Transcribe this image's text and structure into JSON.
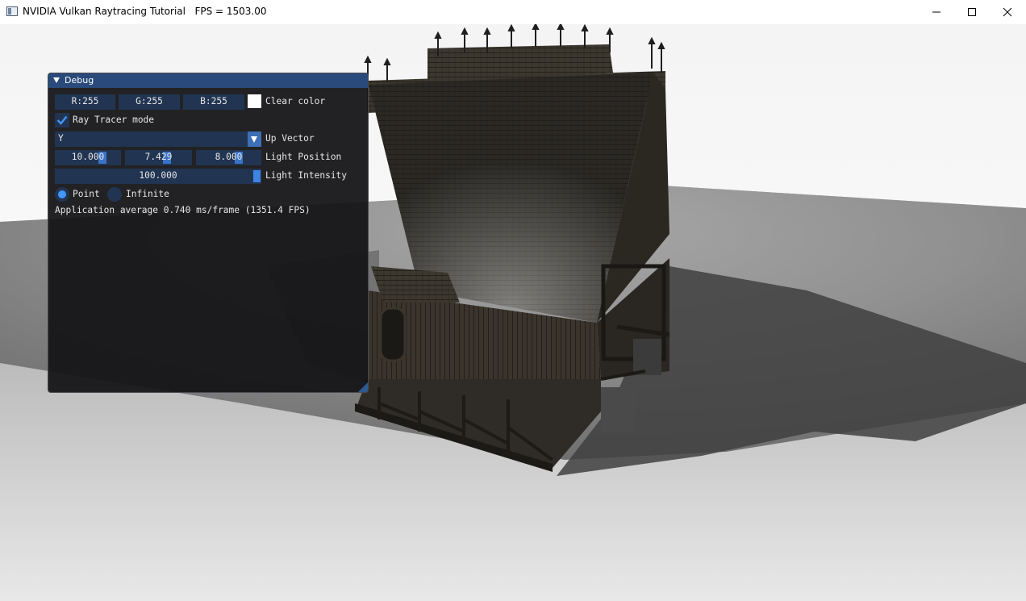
{
  "window": {
    "title": "NVIDIA Vulkan Raytracing Tutorial",
    "fps_text": "FPS = 1503.00"
  },
  "debug_panel": {
    "title": "Debug",
    "clear_color": {
      "r_text": "R:255",
      "g_text": "G:255",
      "b_text": "B:255",
      "label": "Clear color",
      "swatch_color": "#ffffff"
    },
    "ray_tracer_mode": {
      "label": "Ray Tracer mode",
      "checked": true
    },
    "up_vector": {
      "value": "Y",
      "label": "Up Vector"
    },
    "light_position": {
      "x": "10.000",
      "y": "7.429",
      "z": "8.000",
      "label": "Light Position"
    },
    "light_intensity": {
      "value": "100.000",
      "label": "Light Intensity"
    },
    "light_type": {
      "point_label": "Point",
      "infinite_label": "Infinite",
      "selected": "Point"
    },
    "stats_text": "Application average 0.740 ms/frame (1351.4 FPS)"
  },
  "colors": {
    "panel_bg": "#141416",
    "frame_bg": "#213552",
    "title_bg": "#294a7a",
    "accent": "#4296fa"
  },
  "icons": {
    "app": "app-icon",
    "minimize": "minimize-icon",
    "maximize": "maximize-icon",
    "close": "close-icon"
  }
}
